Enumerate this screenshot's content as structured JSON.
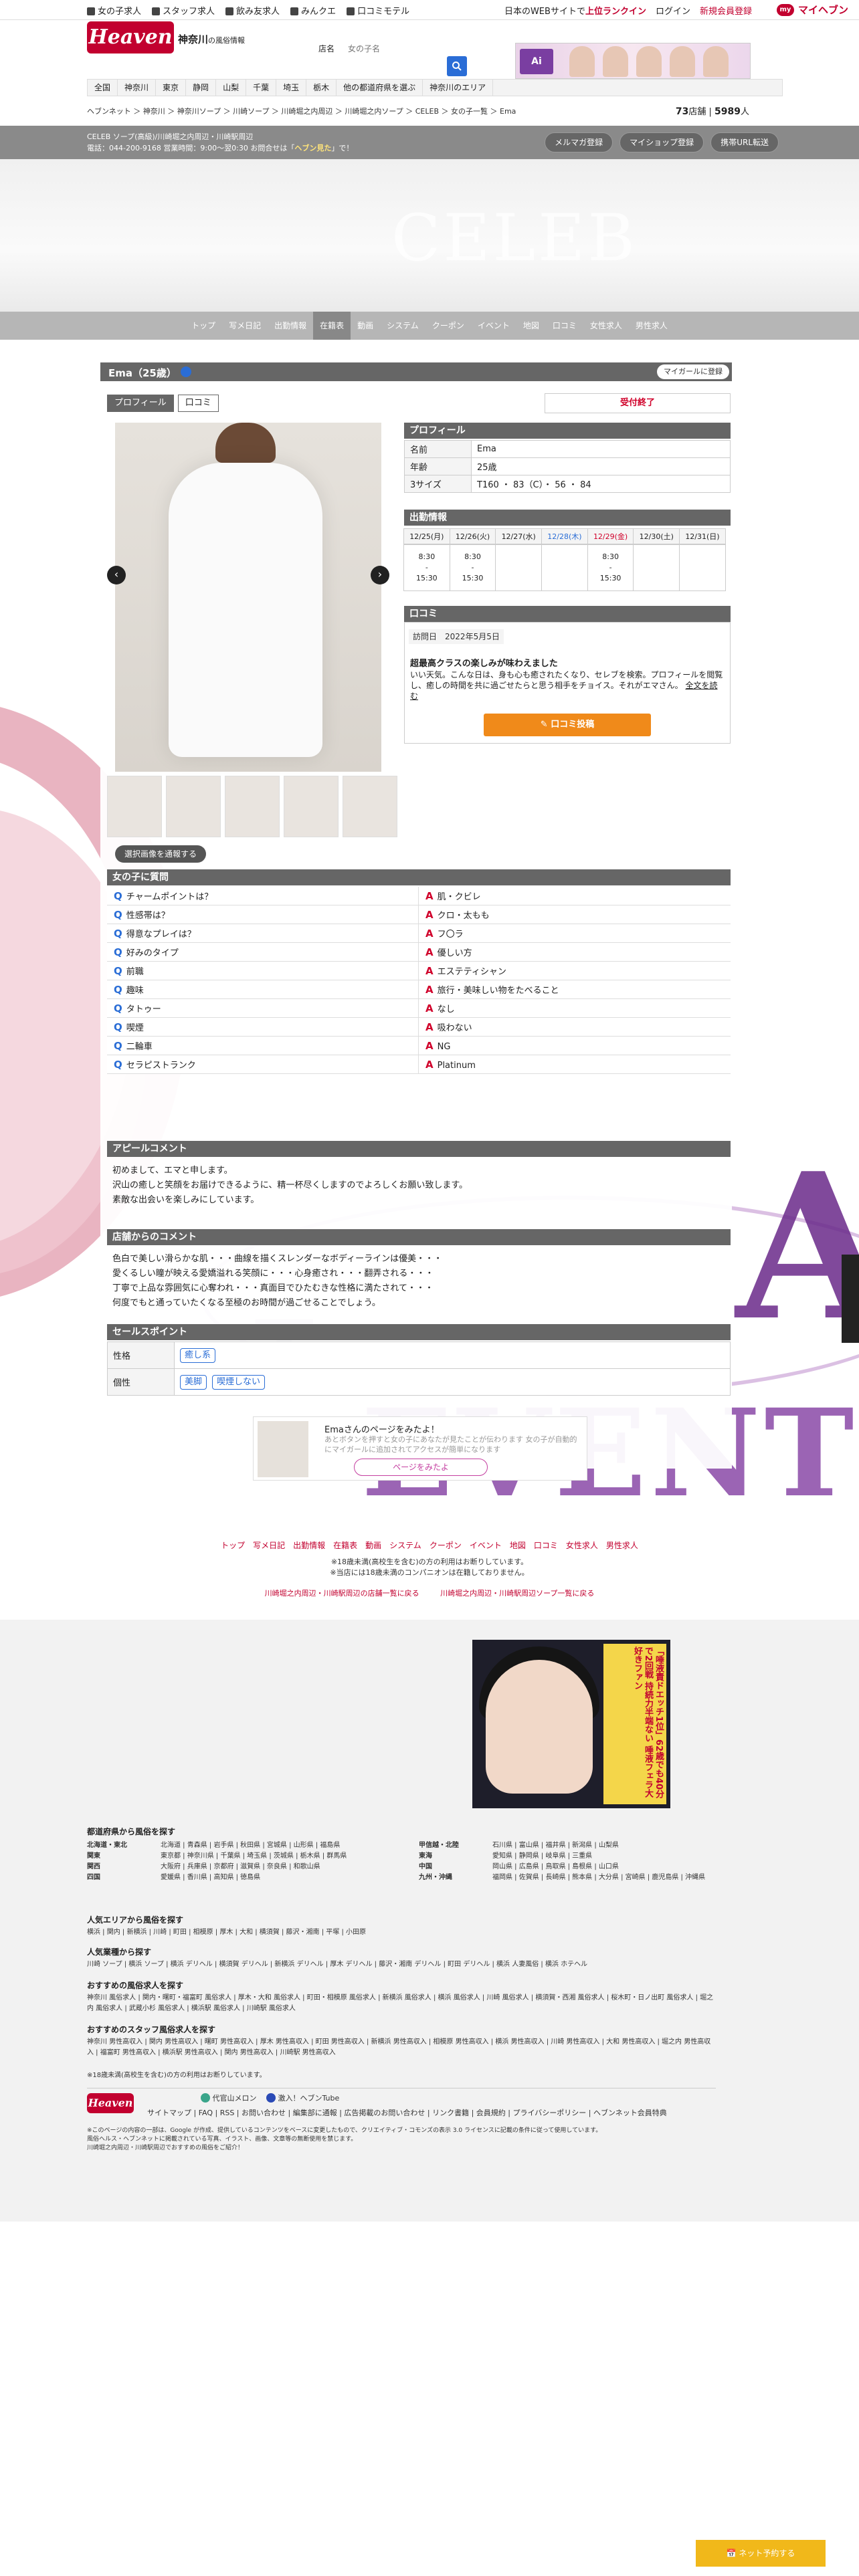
{
  "top_links": [
    "女の子求人",
    "スタッフ求人",
    "飲み友求人",
    "みんクエ",
    "口コミモテル"
  ],
  "top_right": {
    "tagline_prefix": "日本のWEBサイトで",
    "tagline_highlight": "上位ランクイン",
    "login": "ログイン",
    "register": "新規会員登録",
    "myheaven": "マイヘブン"
  },
  "header": {
    "logo": "Heaven",
    "region": "神奈川",
    "region_suffix": "の風俗情報",
    "search_label": "店名",
    "search_placeholder": "女の子名"
  },
  "banner": {
    "tag": "Ai"
  },
  "region_nav": [
    "全国",
    "神奈川",
    "東京",
    "静岡",
    "山梨",
    "千葉",
    "埼玉",
    "栃木",
    "他の都道府県を選ぶ",
    "神奈川のエリア"
  ],
  "breadcrumb": "ヘブンネット ＞ 神奈川 ＞ 神奈川ソープ ＞ 川崎ソープ ＞ 川崎堀之内周辺 ＞ 川崎堀之内ソープ ＞ CELEB ＞ 女の子一覧 ＞ Ema",
  "counts": {
    "shops": "73",
    "shops_unit": "店舗",
    "girls": "5989",
    "girls_unit": "人"
  },
  "shop": {
    "line1": "CELEB ソープ(高級)/川崎堀之内周辺・川崎駅周辺",
    "line2_prefix": "電話：044-200-9168 営業時間：9:00〜翌0:30 お問合せは「",
    "line2_highlight": "ヘブン見た",
    "line2_suffix": "」で！",
    "buttons": [
      "メルマガ登録",
      "マイショップ登録",
      "携帯URL転送"
    ]
  },
  "hero_text": "CELEB",
  "shop_nav": [
    "トップ",
    "写メ日記",
    "出勤情報",
    "在籍表",
    "動画",
    "システム",
    "クーポン",
    "イベント",
    "地図",
    "口コミ",
    "女性求人",
    "男性求人"
  ],
  "shop_nav_active": 3,
  "girl": {
    "name": "Ema（25歳）",
    "mygirl_button": "マイガールに登録",
    "tabs": [
      "プロフィール",
      "口コミ"
    ],
    "status": "受付終了",
    "select_button": "選択画像を通報する"
  },
  "profile": {
    "title": "プロフィール",
    "rows": [
      {
        "k": "名前",
        "v": "Ema"
      },
      {
        "k": "年齢",
        "v": "25歳"
      },
      {
        "k": "3サイズ",
        "v": "T160 ・ 83（C）・ 56 ・ 84"
      }
    ]
  },
  "schedule": {
    "title": "出勤情報",
    "days": [
      "12/25(月)",
      "12/26(火)",
      "12/27(水)",
      "12/28(木)",
      "12/29(金)",
      "12/30(土)",
      "12/31(日)"
    ],
    "times": [
      "8:30\n-\n15:30",
      "8:30\n-\n15:30",
      "",
      "",
      "8:30\n-\n15:30",
      "",
      ""
    ]
  },
  "review": {
    "title": "口コミ",
    "date_label": "訪問日",
    "date": "2022年5月5日",
    "headline": "超最高クラスの楽しみが味わえました",
    "body": "いい天気。こんな日は、身も心も癒されたくなり、セレブを検索。プロフィールを閲覧し、癒しの時間を共に過ごせたらと思う相手をチョイス。それがエマさん。",
    "more": "全文を読む",
    "post_button": "口コミ投稿"
  },
  "qa": {
    "title": "女の子に質問",
    "rows": [
      {
        "q": "チャームポイントは？",
        "a": "肌・クビレ"
      },
      {
        "q": "性感帯は？",
        "a": "クロ・太もも"
      },
      {
        "q": "得意なプレイは？",
        "a": "フ〇ラ"
      },
      {
        "q": "好みのタイプ",
        "a": "優しい方"
      },
      {
        "q": "前職",
        "a": "エステティシャン"
      },
      {
        "q": "趣味",
        "a": "旅行・美味しい物をたべること"
      },
      {
        "q": "タトゥー",
        "a": "なし"
      },
      {
        "q": "喫煙",
        "a": "吸わない"
      },
      {
        "q": "二輪車",
        "a": "NG"
      },
      {
        "q": "セラピストランク",
        "a": "Platinum"
      }
    ]
  },
  "appeal": {
    "title": "アピールコメント",
    "lines": [
      "初めまして、エマと申します。",
      "沢山の癒しと笑顔をお届けできるように、精一杯尽くしますのでよろしくお願い致します。",
      "素敵な出会いを楽しみにしています。"
    ]
  },
  "shop_comment": {
    "title": "店舗からのコメント",
    "lines": [
      "色白で美しい滑らかな肌・・・曲線を描くスレンダーなボディーラインは優美・・・",
      "愛くるしい瞳が映える愛嬌溢れる笑顔に・・・心身癒され・・・翻弄される・・・",
      "丁寧で上品な雰囲気に心奪われ・・・真面目でひたむきな性格に満たされて・・・",
      "何度でもと通っていたくなる至極のお時間が過ごせることでしょう。"
    ]
  },
  "sales": {
    "title": "セールスポイント",
    "rows": [
      {
        "k": "性格",
        "tags": [
          "癒し系"
        ]
      },
      {
        "k": "個性",
        "tags": [
          "美脚",
          "喫煙しない"
        ]
      }
    ]
  },
  "nudge": {
    "title": "Emaさんのページをみたよ！",
    "sub": "あとボタンを押すと女の子にあなたが見たことが伝わります 女の子が自動的にマイガールに追加されてアクセスが簡単になります",
    "button": "ページをみたよ"
  },
  "bottom_nav": [
    "トップ",
    "写メ日記",
    "出勤情報",
    "在籍表",
    "動画",
    "システム",
    "クーポン",
    "イベント",
    "地図",
    "口コミ",
    "女性求人",
    "男性求人"
  ],
  "notes": [
    "※18歳未満(高校生を含む)の方の利用はお断りしています。",
    "※当店には18歳未満のコンパニオンは在籍しておりません。"
  ],
  "bottom_links": [
    "川崎堀之内周辺・川崎駅周辺の店舗一覧に戻る",
    "川崎堀之内周辺・川崎駅周辺ソープ一覧に戻る"
  ],
  "ad": {
    "text": "「唾液責ドエッチ1位」62歳でも40分で2回戦 持続力半端ない 唾液フェラ大好きファン"
  },
  "footer": {
    "pref_title": "都道府県から風俗を探す",
    "pref_rows": [
      {
        "r": "北海道・東北",
        "v": "北海道 | 青森県 | 岩手県 | 秋田県 | 宮城県 | 山形県 | 福島県"
      },
      {
        "r": "関東",
        "v": "東京都 | 神奈川県 | 千葉県 | 埼玉県 | 茨城県 | 栃木県 | 群馬県"
      },
      {
        "r": "関西",
        "v": "大阪府 | 兵庫県 | 京都府 | 滋賀県 | 奈良県 | 和歌山県"
      },
      {
        "r": "四国",
        "v": "愛媛県 | 香川県 | 高知県 | 徳島県"
      }
    ],
    "pref_rows_r": [
      {
        "r": "甲信越・北陸",
        "v": "石川県 | 富山県 | 福井県 | 新潟県 | 山梨県"
      },
      {
        "r": "東海",
        "v": "愛知県 | 静岡県 | 岐阜県 | 三重県"
      },
      {
        "r": "中国",
        "v": "岡山県 | 広島県 | 鳥取県 | 島根県 | 山口県"
      },
      {
        "r": "九州・沖縄",
        "v": "福岡県 | 佐賀県 | 長崎県 | 熊本県 | 大分県 | 宮崎県 | 鹿児島県 | 沖縄県"
      }
    ],
    "area_title": "人気エリアから風俗を探す",
    "area_links": "横浜 | 関内 | 新横浜 | 川崎 | 町田 | 相模原 | 厚木 | 大和 | 横須賀 | 藤沢・湘南 | 平塚 | 小田原",
    "genre_title": "人気業種から探す",
    "genre_links": "川崎 ソープ | 横浜 ソープ | 横浜 デリヘル | 横須賀 デリヘル | 新横浜 デリヘル | 厚木 デリヘル | 藤沢・湘南 デリヘル | 町田 デリヘル | 横浜 人妻風俗 | 横浜 ホテヘル",
    "job_title": "おすすめの風俗求人を探す",
    "job_links": "神奈川 風俗求人 | 関内・曙町・福富町 風俗求人 | 厚木・大和 風俗求人 | 町田・相模原 風俗求人 | 新横浜 風俗求人 | 横浜 風俗求人 | 川崎 風俗求人 | 横須賀・西湘 風俗求人 | 桜木町・日ノ出町 風俗求人 | 堀之内 風俗求人 | 武蔵小杉 風俗求人 | 横浜駅 風俗求人 | 川崎駅 風俗求人",
    "staff_title": "おすすめのスタッフ風俗求人を探す",
    "staff_links": "神奈川 男性高収入 | 関内 男性高収入 | 曙町 男性高収入 | 厚木 男性高収入 | 町田 男性高収入 | 新横浜 男性高収入 | 相模原 男性高収入 | 横浜 男性高収入 | 川崎 男性高収入 | 大和 男性高収入 | 堀之内 男性高収入 | 福富町 男性高収入 | 横浜駅 男性高収入 | 関内 男性高収入 | 川崎駅 男性高収入",
    "age_note": "※18歳未満(高校生を含む)の方の利用はお断りしています。",
    "apps": [
      "代官山メロン",
      "激入！ヘブンTube"
    ],
    "links": "サイトマップ | FAQ | RSS | お問い合わせ | 編集部に通報 | 広告掲載のお問い合わせ | リンク書籍 | 会員規約 | プライバシーポリシー | ヘブンネット会員特典",
    "copyright": "※このページの内容の一部は、Google が作成、提供しているコンテンツをベースに変更したもので、クリエイティブ・コモンズの表示 3.0 ライセンスに記載の条件に従って使用しています。",
    "copyright2": "風俗ヘルス・ヘブンネットに掲載されている写真、イラスト、画像、文章等の無断使用を禁じます。",
    "copyright3": "川崎堀之内周辺・川崎駅周辺でおすすめの風俗をご紹介！"
  },
  "fixed_button": "ネット予約する"
}
